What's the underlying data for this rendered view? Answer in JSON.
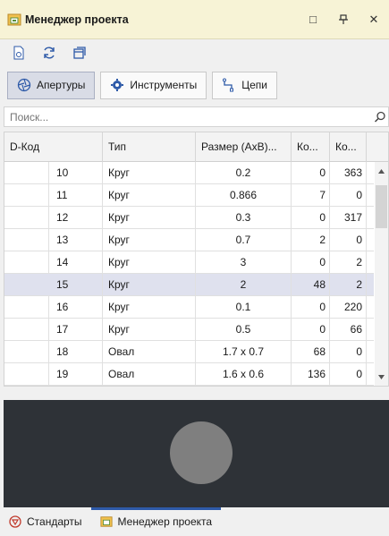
{
  "window": {
    "title": "Менеджер проекта",
    "buttons": [
      "□",
      "ᚒ",
      "✕"
    ]
  },
  "toolbar": {
    "icons": [
      "document-settings-icon",
      "refresh-icon",
      "copy-panel-icon"
    ]
  },
  "tabs": [
    {
      "label": "Апертуры",
      "icon": "aperture-icon",
      "active": true
    },
    {
      "label": "Инструменты",
      "icon": "tools-gear-icon",
      "active": false
    },
    {
      "label": "Цепи",
      "icon": "net-icon",
      "active": false
    }
  ],
  "search": {
    "placeholder": "Поиск..."
  },
  "table": {
    "headers": [
      "D-Код",
      "Тип",
      "Размер (AxB)...",
      "Ко...",
      "Ко..."
    ],
    "rows": [
      {
        "code": "10",
        "type": "Круг",
        "size": "0.2",
        "k1": "0",
        "k2": "363"
      },
      {
        "code": "11",
        "type": "Круг",
        "size": "0.866",
        "k1": "7",
        "k2": "0"
      },
      {
        "code": "12",
        "type": "Круг",
        "size": "0.3",
        "k1": "0",
        "k2": "317"
      },
      {
        "code": "13",
        "type": "Круг",
        "size": "0.7",
        "k1": "2",
        "k2": "0"
      },
      {
        "code": "14",
        "type": "Круг",
        "size": "3",
        "k1": "0",
        "k2": "2"
      },
      {
        "code": "15",
        "type": "Круг",
        "size": "2",
        "k1": "48",
        "k2": "2"
      },
      {
        "code": "16",
        "type": "Круг",
        "size": "0.1",
        "k1": "0",
        "k2": "220"
      },
      {
        "code": "17",
        "type": "Круг",
        "size": "0.5",
        "k1": "0",
        "k2": "66"
      },
      {
        "code": "18",
        "type": "Овал",
        "size": "1.7 x 0.7",
        "k1": "68",
        "k2": "0"
      },
      {
        "code": "19",
        "type": "Овал",
        "size": "1.6 x 0.6",
        "k1": "136",
        "k2": "0"
      }
    ],
    "selected_index": 5
  },
  "preview": {
    "shape": "circle",
    "background": "#2e3237",
    "fill": "#7f7f7f"
  },
  "bottom_tabs": [
    {
      "label": "Стандарты",
      "icon": "standards-icon",
      "active": false
    },
    {
      "label": "Менеджер проекта",
      "icon": "project-manager-icon",
      "active": true
    }
  ],
  "colors": {
    "title_bg": "#f7f3d6",
    "selected_row": "#dfe1ee",
    "active_tab_accent": "#2e5aa8"
  }
}
